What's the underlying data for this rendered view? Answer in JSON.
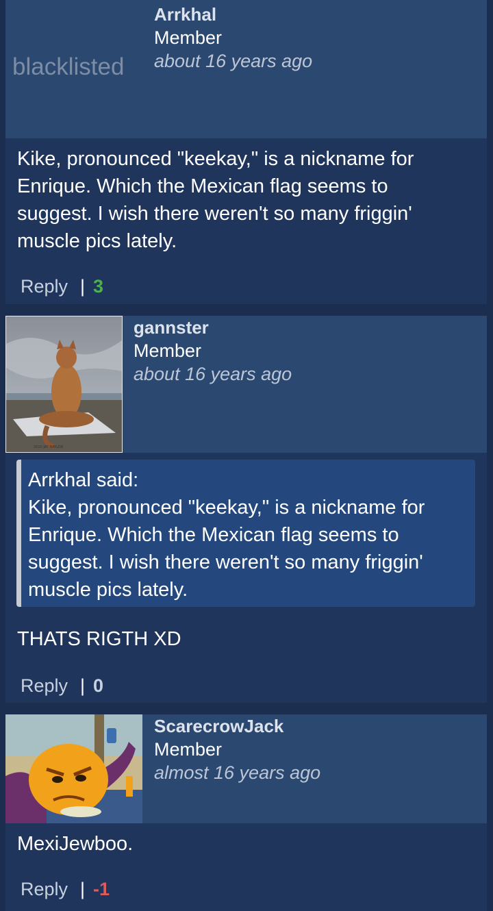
{
  "comments": [
    {
      "username": "Arrkhal",
      "role": "Member",
      "time": "about 16 years ago",
      "avatar_text": "blacklisted",
      "body": "Kike, pronounced \"keekay,\" is a nickname for Enrique. Which the Mexican flag seems to suggest. I wish there weren't so many friggin' muscle pics lately.",
      "reply_label": "Reply",
      "separator": "|",
      "score": "3"
    },
    {
      "username": "gannster",
      "role": "Member",
      "time": "about 16 years ago",
      "quote": {
        "author": "Arrkhal said:",
        "text": "Kike, pronounced \"keekay,\" is a nickname for Enrique. Which the Mexican flag seems to suggest. I wish there weren't so many friggin' muscle pics lately."
      },
      "body": "THATS RIGTH XD",
      "reply_label": "Reply",
      "separator": "|",
      "score": "0"
    },
    {
      "username": "ScarecrowJack",
      "role": "Member",
      "time": "almost 16 years ago",
      "body": "MexiJewboo.",
      "reply_label": "Reply",
      "separator": "|",
      "score": "-1"
    }
  ],
  "colors": {
    "score_positive": "#4caf50",
    "score_zero": "#c8d1df",
    "score_negative": "#e05a5a"
  },
  "icons": {
    "avatar_2": "cat-character-meditating-avatar",
    "avatar_3": "pumpkin-character-avatar"
  }
}
